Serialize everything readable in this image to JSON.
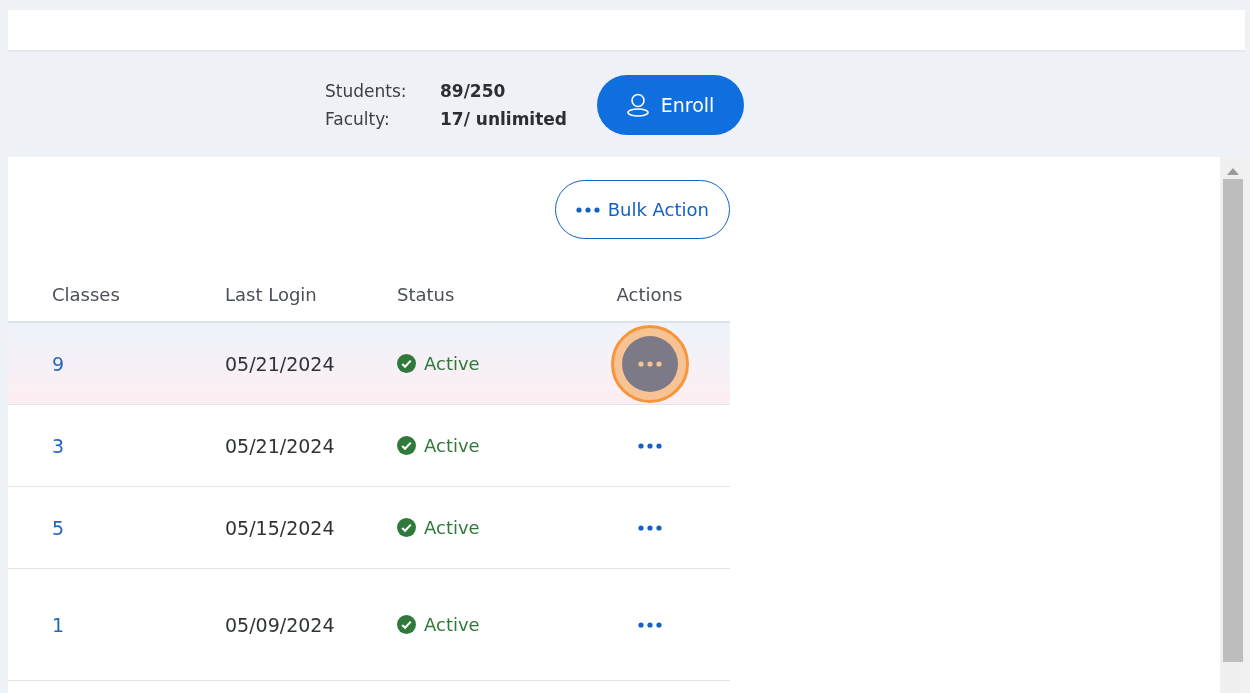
{
  "summary": {
    "stats": [
      {
        "label": "Students:",
        "value": "89/250"
      },
      {
        "label": "Faculty:",
        "value": "17/ unlimited"
      }
    ],
    "enroll_button": "Enroll"
  },
  "bulk_action_button": "Bulk Action",
  "table": {
    "columns": [
      "Classes",
      "Last Login",
      "Status",
      "Actions"
    ],
    "rows": [
      {
        "classes": "9",
        "last_login": "05/21/2024",
        "status": "Active",
        "selected": true
      },
      {
        "classes": "3",
        "last_login": "05/21/2024",
        "status": "Active",
        "selected": false
      },
      {
        "classes": "5",
        "last_login": "05/15/2024",
        "status": "Active",
        "selected": false
      },
      {
        "classes": "1",
        "last_login": "05/09/2024",
        "status": "Active",
        "selected": false
      }
    ]
  }
}
